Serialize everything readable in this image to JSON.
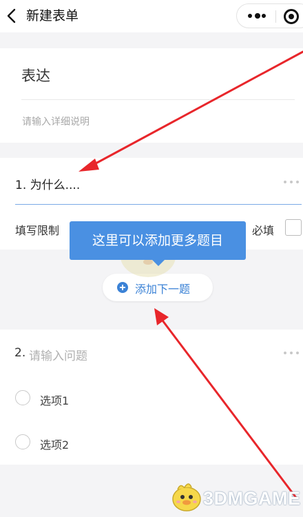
{
  "topbar": {
    "back_icon": "chevron-left-icon",
    "title": "新建表单",
    "more_icon": "more-dots-icon",
    "close_icon": "target-icon"
  },
  "form": {
    "title": "表达",
    "description_placeholder": "请输入详细说明"
  },
  "question1": {
    "text": "1. 为什么....",
    "limit_label": "填写限制",
    "required_label": "必填",
    "required_checked": false
  },
  "tooltip": {
    "text": "这里可以添加更多题目"
  },
  "add_button": {
    "label": "添加下一题",
    "icon": "plus-circle-icon"
  },
  "question2": {
    "number": "2.",
    "placeholder": "请输入问题",
    "options": [
      "选项1",
      "选项2"
    ]
  },
  "watermark": {
    "text": "3DMGAME"
  },
  "colors": {
    "accent": "#3b82d6",
    "tooltip_bg": "#4a90e2",
    "arrow": "#e8262b",
    "page_bg": "#f4f4f6"
  }
}
